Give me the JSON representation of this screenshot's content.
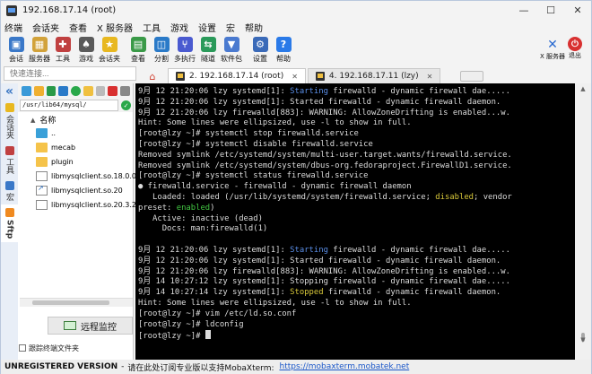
{
  "window": {
    "title": "192.168.17.14 (root)",
    "controls": [
      "—",
      "☐",
      "✕"
    ]
  },
  "menu": [
    "终端",
    "会话夹",
    "查看",
    "X 服务器",
    "工具",
    "游戏",
    "设置",
    "宏",
    "帮助"
  ],
  "toolbar": {
    "items": [
      {
        "label": "会话",
        "icon": "session-icon",
        "color": "#3a78c8"
      },
      {
        "label": "服务器",
        "icon": "servers-icon",
        "color": "#d2a23a"
      },
      {
        "label": "工具",
        "icon": "tools-icon",
        "color": "#c04040"
      },
      {
        "label": "游戏",
        "icon": "games-icon",
        "color": "#5a5a5a"
      },
      {
        "label": "会话夹",
        "icon": "star-icon",
        "color": "#e8b820"
      },
      {
        "label": "查看",
        "icon": "view-icon",
        "color": "#3a9a48"
      },
      {
        "label": "分割",
        "icon": "split-icon",
        "color": "#2a7ac8"
      },
      {
        "label": "多执行",
        "icon": "multiexec-icon",
        "color": "#4a5ad0"
      },
      {
        "label": "隧道",
        "icon": "tunnel-icon",
        "color": "#2a9a5a"
      },
      {
        "label": "软件包",
        "icon": "packages-icon",
        "color": "#4a7ad0"
      },
      {
        "label": "设置",
        "icon": "settings-icon",
        "color": "#3a6ab8"
      },
      {
        "label": "帮助",
        "icon": "help-icon",
        "color": "#2a7ae8"
      }
    ],
    "xserver_label": "X 服务器",
    "exit_label": "退出"
  },
  "quickconnect": {
    "placeholder": "快速连接..."
  },
  "tabs": [
    {
      "label": "2. 192.168.17.14 (root)",
      "active": true
    },
    {
      "label": "4. 192.168.17.11 (lzy)",
      "active": false
    }
  ],
  "vertical_tabs": [
    "会话夹",
    "工具",
    "宏",
    "Sftp"
  ],
  "sftp": {
    "path": "/usr/lib64/mysql/",
    "column_header": "名称",
    "items": [
      {
        "name": "..",
        "type": "parent"
      },
      {
        "name": "mecab",
        "type": "folder"
      },
      {
        "name": "plugin",
        "type": "folder"
      },
      {
        "name": "libmysqlclient.so.18.0.0",
        "type": "file"
      },
      {
        "name": "libmysqlclient.so.20",
        "type": "link"
      },
      {
        "name": "libmysqlclient.so.20.3.25",
        "type": "file"
      }
    ],
    "monitor_label": "远程监控",
    "follow_label": "跟踪终端文件夹"
  },
  "terminal": {
    "lines": [
      [
        {
          "t": "9月 12 21:20:06 lzy systemd[1]: "
        },
        {
          "t": "Starting",
          "c": "blue"
        },
        {
          "t": " firewalld - dynamic firewall dae....."
        }
      ],
      [
        {
          "t": "9月 12 21:20:06 lzy systemd[1]: Started firewalld - dynamic firewall daemon."
        }
      ],
      [
        {
          "t": "9月 12 21:20:06 lzy firewalld[883]: WARNING: AllowZoneDrifting is enabled...w."
        }
      ],
      [
        {
          "t": "Hint: Some lines were ellipsized, use -l to show in full."
        }
      ],
      [
        {
          "t": "[root@lzy ~]# systemctl stop firewalld.service"
        }
      ],
      [
        {
          "t": "[root@lzy ~]# systemctl disable firewalld.service"
        }
      ],
      [
        {
          "t": "Removed symlink /etc/systemd/system/multi-user.target.wants/firewalld.service."
        }
      ],
      [
        {
          "t": "Removed symlink /etc/systemd/system/dbus-org.fedoraproject.FirewallD1.service."
        }
      ],
      [
        {
          "t": "[root@lzy ~]# systemctl status firewalld.service"
        }
      ],
      [
        {
          "t": "● firewalld.service - firewalld - dynamic firewall daemon"
        }
      ],
      [
        {
          "t": "   Loaded: loaded (/usr/lib/systemd/system/firewalld.service; "
        },
        {
          "t": "disabled",
          "c": "yellow"
        },
        {
          "t": "; vendor"
        }
      ],
      [
        {
          "t": "preset: "
        },
        {
          "t": "enabled",
          "c": "green"
        },
        {
          "t": ")"
        }
      ],
      [
        {
          "t": "   Active: inactive (dead)"
        }
      ],
      [
        {
          "t": "     Docs: man:firewalld(1)"
        }
      ],
      [
        {
          "t": ""
        }
      ],
      [
        {
          "t": "9月 12 21:20:06 lzy systemd[1]: "
        },
        {
          "t": "Starting",
          "c": "blue"
        },
        {
          "t": " firewalld - dynamic firewall dae....."
        }
      ],
      [
        {
          "t": "9月 12 21:20:06 lzy systemd[1]: Started firewalld - dynamic firewall daemon."
        }
      ],
      [
        {
          "t": "9月 12 21:20:06 lzy firewalld[883]: WARNING: AllowZoneDrifting is enabled...w."
        }
      ],
      [
        {
          "t": "9月 14 10:27:12 lzy systemd[1]: Stopping firewalld - dynamic firewall dae....."
        }
      ],
      [
        {
          "t": "9月 14 10:27:14 lzy systemd[1]: "
        },
        {
          "t": "Stopped",
          "c": "yellow"
        },
        {
          "t": " firewalld - dynamic firewall daemon."
        }
      ],
      [
        {
          "t": "Hint: Some lines were ellipsized, use -l to show in full."
        }
      ],
      [
        {
          "t": "[root@lzy ~]# vim /etc/ld.so.conf"
        }
      ],
      [
        {
          "t": "[root@lzy ~]# ldconfig"
        }
      ],
      [
        {
          "t": "[root@lzy ~]# ",
          "cursor": true
        }
      ]
    ]
  },
  "status": {
    "unregistered": "UNREGISTERED VERSION",
    "dash": "-",
    "message": "请在此处订阅专业版以支持MobaXterm:",
    "link": "https://mobaxterm.mobatek.net"
  },
  "colors": {
    "blue": "#5b8fe8",
    "green": "#43c843",
    "yellow": "#d8c83a"
  }
}
